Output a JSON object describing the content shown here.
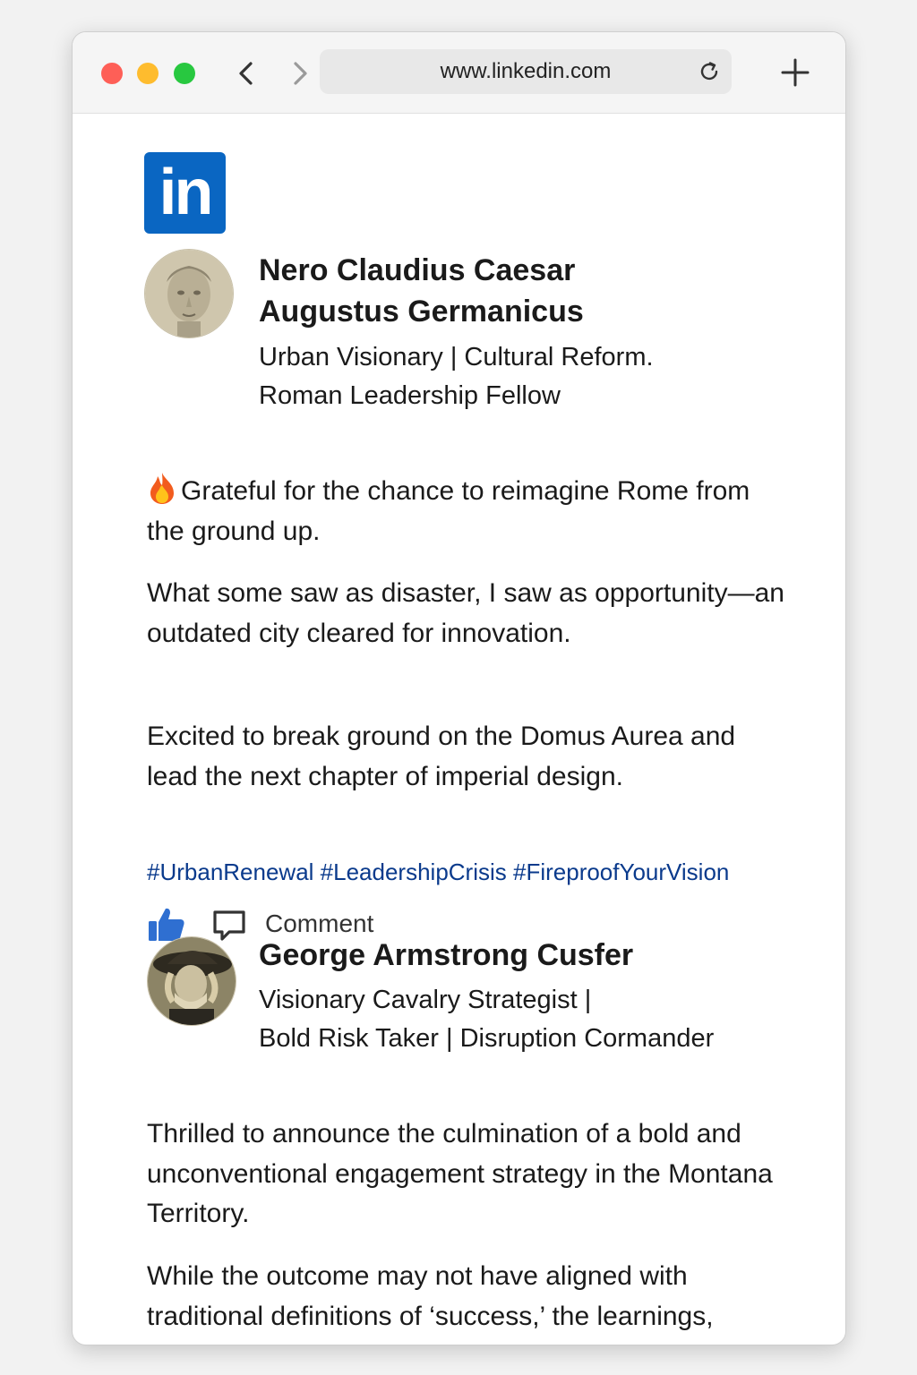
{
  "browser": {
    "url": "www.linkedin.com",
    "icons": [
      "back-arrow-icon",
      "forward-arrow-icon",
      "reload-icon",
      "plus-icon"
    ]
  },
  "logo": {
    "text": "in",
    "color": "#0a66c2"
  },
  "post1": {
    "name_line1": "Nero Claudius Caesar",
    "name_line2": "Augustus Germanicus",
    "headline_line1": "Urban Visionary | Cultural Reform.",
    "headline_line2": "Roman Leadership Fellow",
    "paragraph1": "Grateful for the chance to reimagine Rome from the ground up.",
    "paragraph2": "What some saw as disaster, I saw as opportunity—an outdated city cleared for innovation.",
    "paragraph3": "Excited to break ground on the Domus Aurea and lead the next chapter of imperial design.",
    "hashtags": "#UrbanRenewal #LeadershipCrisis #FireproofYourVision",
    "comment_label": "Comment",
    "emoji": "fire-icon"
  },
  "post2": {
    "name": "George Armstrong Cusfer",
    "headline_line1": "Visionary Cavalry Strategist |",
    "headline_line2": "Bold Risk Taker | Disruption Cormander",
    "paragraph1": "Thrilled to announce the culmination of a bold and unconventional engagement strategy in the Montana Territory.",
    "paragraph2": "While the outcome may not have aligned with traditional definitions of ‘success,’ the learnings, leadership growth, and frontier"
  },
  "colors": {
    "accent": "#0a66c2",
    "hashtag": "#0a3a8c",
    "like": "#2f6fd1"
  }
}
